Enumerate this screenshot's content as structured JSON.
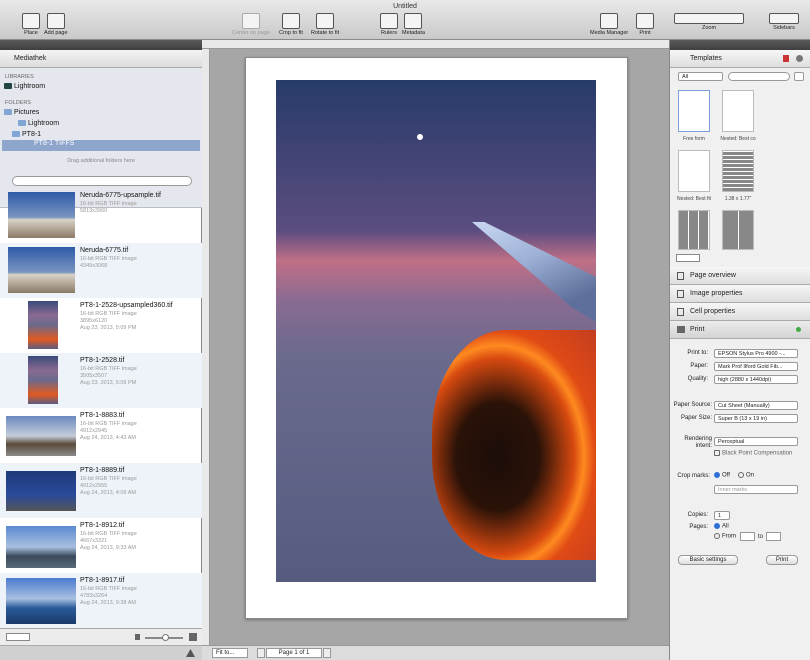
{
  "window": {
    "title": "Untitled"
  },
  "toolbar": {
    "place": "Place",
    "add_page": "Add page",
    "center_on_page": "Center on page",
    "crop_to_fit": "Crop to fit",
    "rotate_to_fit": "Rotate to fit",
    "rulers": "Rulers",
    "metadata": "Metadata",
    "media_manager": "Media Manager",
    "print": "Print",
    "zoom": "Zoom",
    "sidebars": "Sidebars"
  },
  "left": {
    "tab": "Mediathek",
    "libraries_header": "LIBRARIES",
    "lightroom_lib": "Lightroom",
    "folders_header": "FOLDERS",
    "folders": [
      "Pictures",
      "Lightroom",
      "PT8-1",
      "PT8-1 TIFFS"
    ],
    "drag_hint": "Drag additional folders here",
    "items": [
      {
        "name": "Neruda-6775-upsample.tif",
        "type": "16-bit RGB TIFF image",
        "dims": "5813x3960",
        "date": ""
      },
      {
        "name": "Neruda-6775.tif",
        "type": "16-bit RGB TIFF image",
        "dims": "4349x3068",
        "date": ""
      },
      {
        "name": "PT8-1-2528-upsampled360.tif",
        "type": "16-bit RGB TIFF image",
        "dims": "3895x6120",
        "date": "Aug 23, 2013, 5:09 PM"
      },
      {
        "name": "PT8-1-2528.tif",
        "type": "16-bit RGB TIFF image",
        "dims": "3505x3507",
        "date": "Aug 23, 2013, 5:09 PM"
      },
      {
        "name": "PT8-1-8883.tif",
        "type": "16-bit RGB TIFF image",
        "dims": "4912x2945",
        "date": "Aug 24, 2013, 4:43 AM"
      },
      {
        "name": "PT8-1-8889.tif",
        "type": "16-bit RGB TIFF image",
        "dims": "4912x2955",
        "date": "Aug 24, 2013, 4:09 AM"
      },
      {
        "name": "PT8-1-8912.tif",
        "type": "16-bit RGB TIFF image",
        "dims": "4667x3321",
        "date": "Aug 24, 2013, 9:33 AM"
      },
      {
        "name": "PT8-1-8917.tif",
        "type": "16-bit RGB TIFF image",
        "dims": "4783x3264",
        "date": "Aug 24, 2013, 9:38 AM"
      }
    ]
  },
  "bottom": {
    "fit": "Fit to...",
    "page": "Page 1 of 1"
  },
  "right": {
    "templates_tab": "Templates",
    "filter": "All",
    "templates": [
      "Free form",
      "Nested: Best co",
      "Nested: Best fit",
      "1.38 x 1.77\""
    ],
    "page_overview": "Page overview",
    "image_properties": "Image properties",
    "cell_properties": "Cell properties",
    "print_section": "Print",
    "print_to_label": "Print to:",
    "print_to": "EPSON Stylus Pro 4900 -...",
    "paper_label": "Paper:",
    "paper": "Mark Prof Ilford Gold Fib...",
    "quality_label": "Quality:",
    "quality": "high (2880 x 1440dpi)",
    "source_label": "Paper Source:",
    "source": "Cut Sheet (Manually)",
    "size_label": "Paper Size:",
    "size": "Super B (13 x 19 in)",
    "rendering_label": "Rendering intent:",
    "rendering": "Perceptual",
    "bpc": "Black Point Compensation",
    "crop_label": "Crop marks:",
    "crop_off": "Off",
    "crop_on": "On",
    "inner_marks": "Inner marks",
    "copies_label": "Copies:",
    "copies": "1",
    "pages_label": "Pages:",
    "pages_all": "All",
    "pages_from": "From",
    "pages_to": "to",
    "basic_settings": "Basic settings",
    "print_button": "Print"
  }
}
